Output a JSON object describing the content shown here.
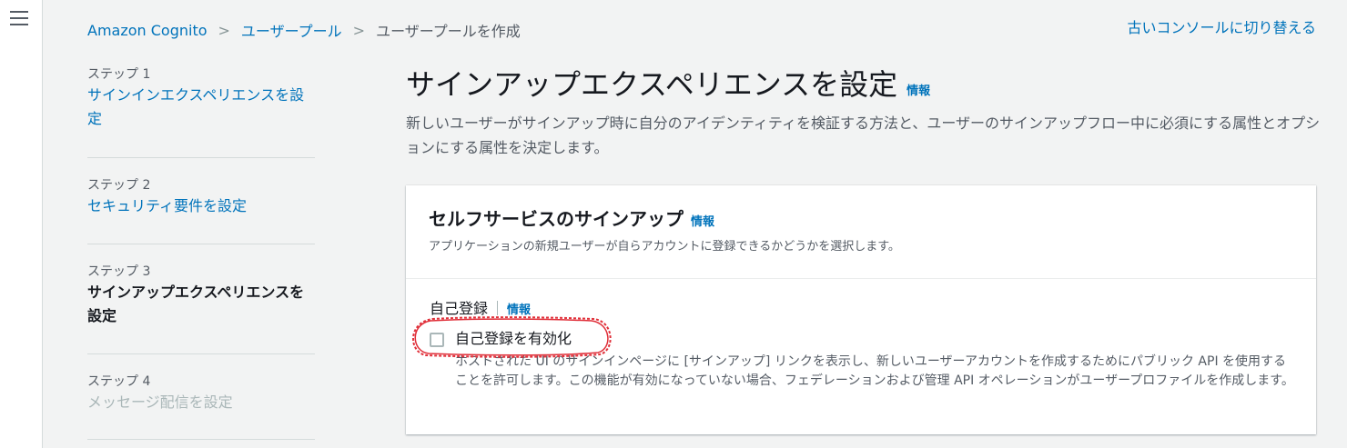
{
  "nav": {
    "menu_icon": "hamburger-menu-icon"
  },
  "breadcrumbs": {
    "item1": "Amazon Cognito",
    "item2": "ユーザープール",
    "current": "ユーザープールを作成",
    "separator": "chevron-right-icon"
  },
  "header": {
    "switch_console": "古いコンソールに切り替える"
  },
  "steps": [
    {
      "label": "ステップ 1",
      "name": "サインインエクスペリエンスを設定",
      "state": "link"
    },
    {
      "label": "ステップ 2",
      "name": "セキュリティ要件を設定",
      "state": "link"
    },
    {
      "label": "ステップ 3",
      "name": "サインアップエクスペリエンスを設定",
      "state": "current"
    },
    {
      "label": "ステップ 4",
      "name": "メッセージ配信を設定",
      "state": "disabled"
    }
  ],
  "page": {
    "title": "サインアップエクスペリエンスを設定",
    "info": "情報",
    "description": "新しいユーザーがサインアップ時に自分のアイデンティティを検証する方法と、ユーザーのサインアップフロー中に必須にする属性とオプションにする属性を決定します。"
  },
  "card": {
    "title": "セルフサービスのサインアップ",
    "info": "情報",
    "subtitle": "アプリケーションの新規ユーザーが自らアカウントに登録できるかどうかを選択します。",
    "field_label": "自己登録",
    "field_info": "情報",
    "checkbox_label": "自己登録を有効化",
    "checkbox_checked": false,
    "checkbox_description": "ホストされた UI のサインインページに [サインアップ] リンクを表示し、新しいユーザーアカウントを作成するためにパブリック API を使用することを許可します。この機能が有効になっていない場合、フェデレーションおよび管理 API オペレーションがユーザープロファイルを作成します。"
  },
  "colors": {
    "link": "#0073bb",
    "annotation": "#e0303a",
    "background": "#f2f3f3"
  }
}
